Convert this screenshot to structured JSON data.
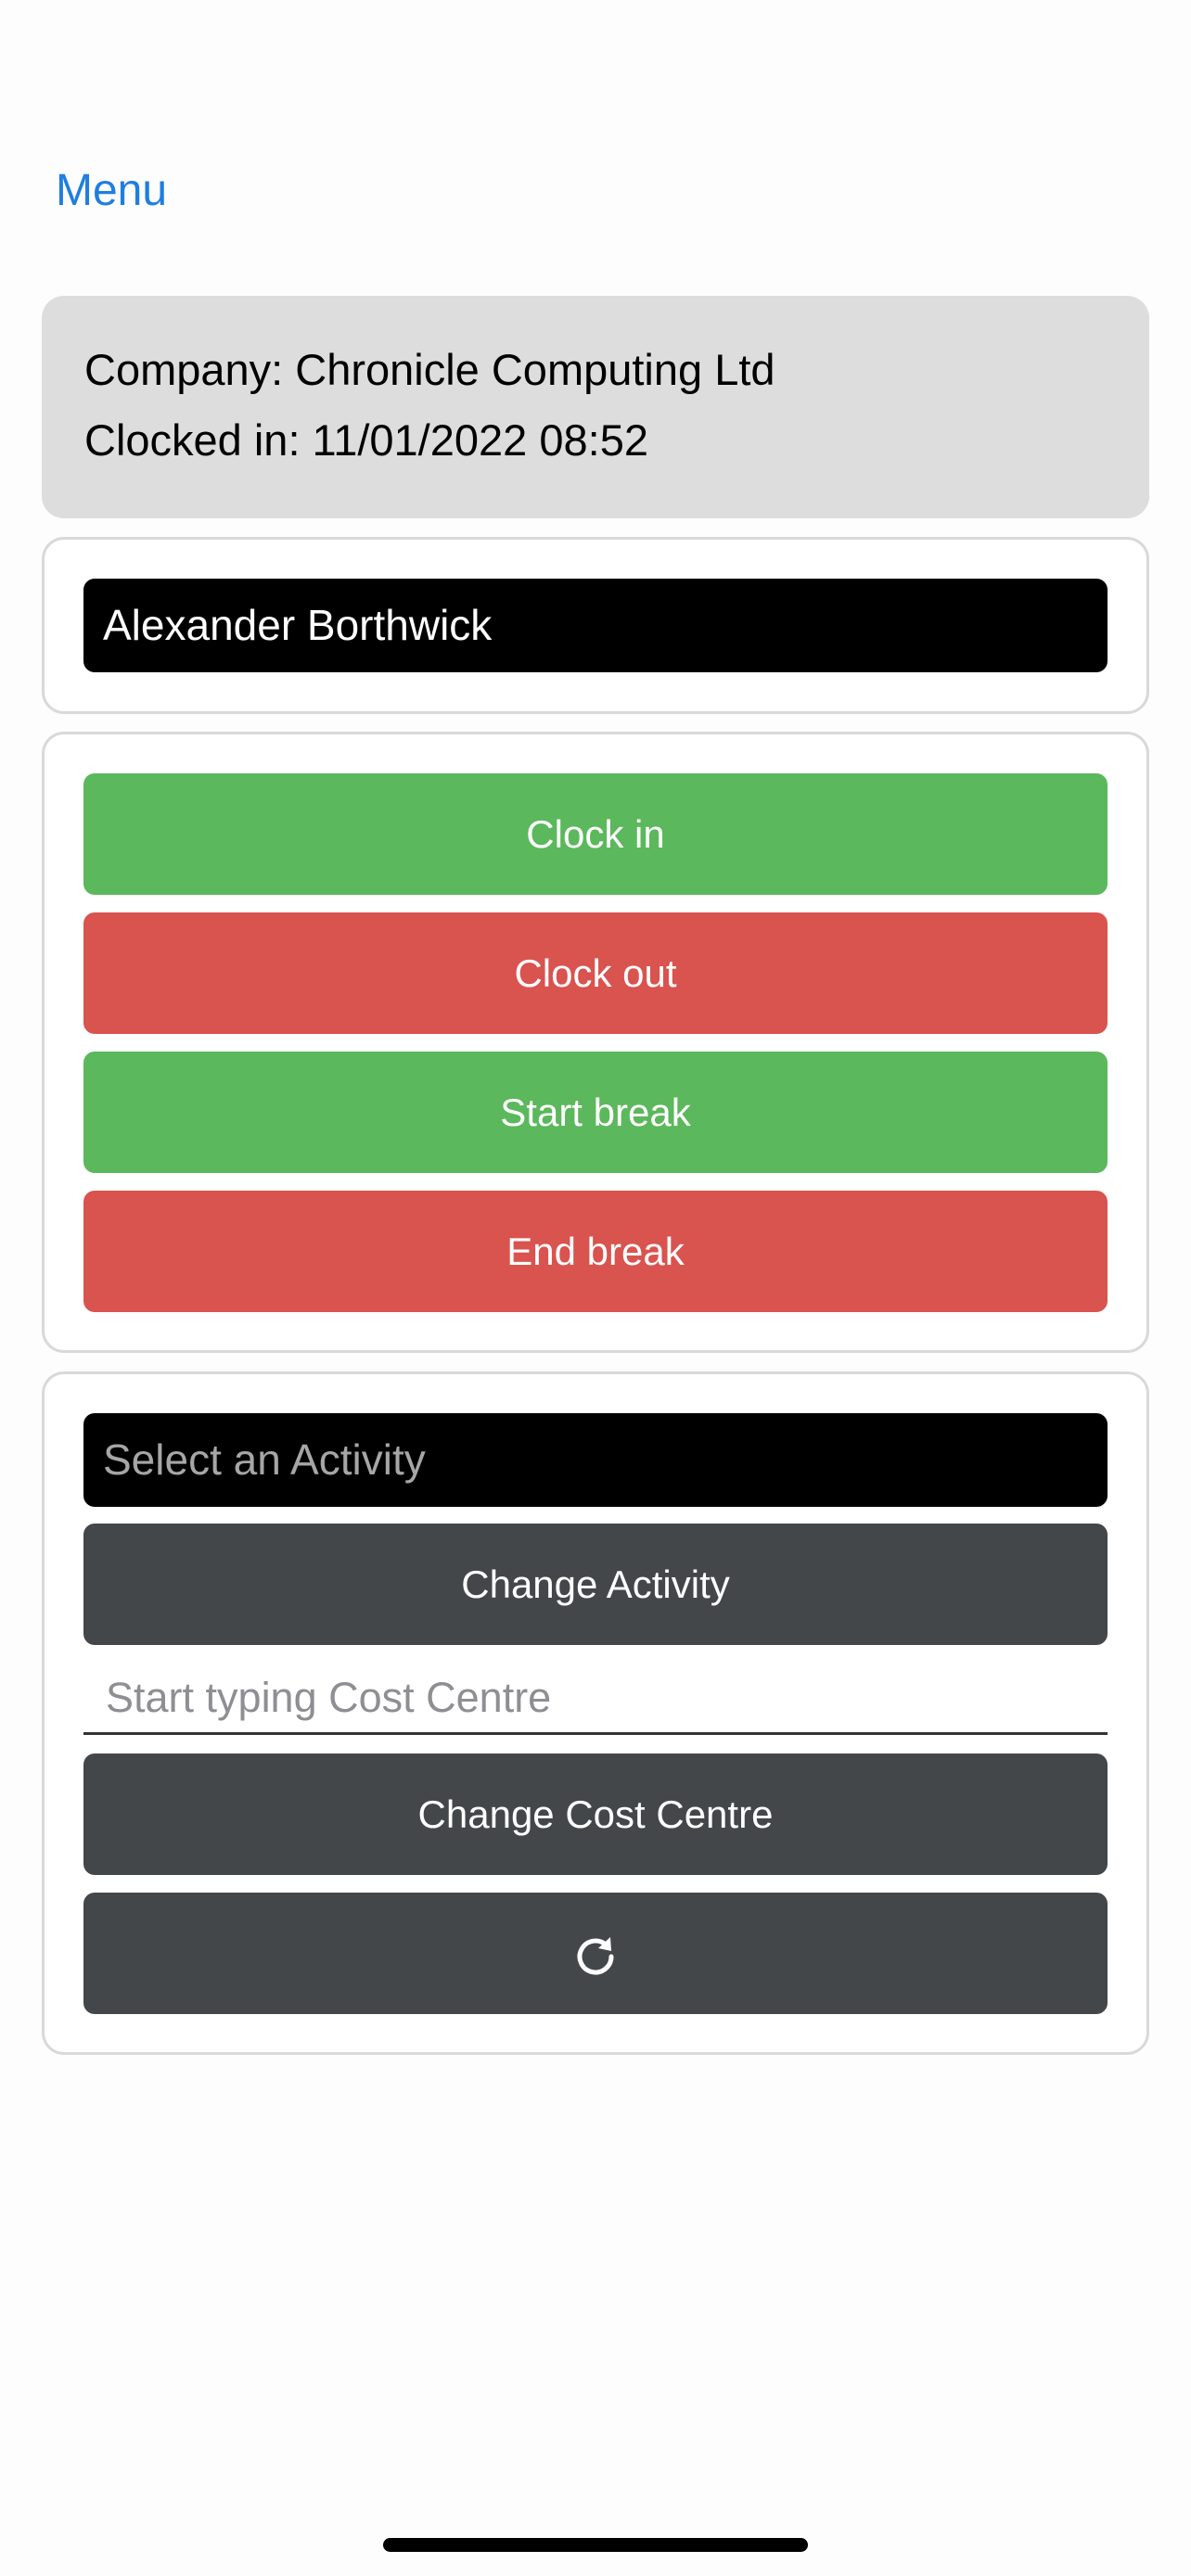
{
  "nav": {
    "menu_label": "Menu"
  },
  "info": {
    "company": "Company: Chronicle Computing Ltd",
    "clocked_in": "Clocked in: 11/01/2022 08:52"
  },
  "employee": {
    "name": "Alexander Borthwick"
  },
  "actions": {
    "clock_in": "Clock in",
    "clock_out": "Clock out",
    "start_break": "Start break",
    "end_break": "End break"
  },
  "activity": {
    "select_placeholder": "Select an Activity",
    "change_activity": "Change Activity",
    "cost_centre_placeholder": "Start typing Cost Centre",
    "cost_centre_value": "",
    "change_cost_centre": "Change Cost Centre",
    "refresh_icon": "refresh-icon"
  },
  "colors": {
    "link": "#1f7ee0",
    "success": "#5cb85c",
    "danger": "#d9534f",
    "dark": "#43474a",
    "info_bg": "#dddddd"
  }
}
